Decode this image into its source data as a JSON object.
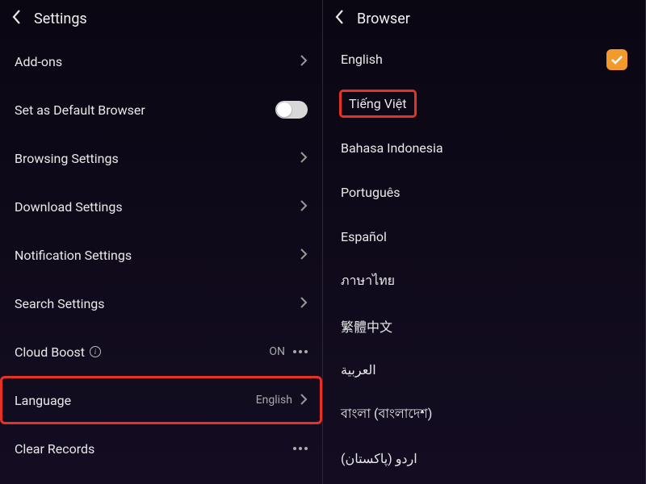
{
  "left": {
    "title": "Settings",
    "items": [
      {
        "label": "Add-ons",
        "type": "chevron"
      },
      {
        "label": "Set as Default Browser",
        "type": "toggle",
        "toggled": false
      },
      {
        "label": "Browsing Settings",
        "type": "chevron"
      },
      {
        "label": "Download Settings",
        "type": "chevron"
      },
      {
        "label": "Notification Settings",
        "type": "chevron"
      },
      {
        "label": "Search Settings",
        "type": "chevron"
      },
      {
        "label": "Cloud Boost",
        "type": "status-dots",
        "info": true,
        "status": "ON"
      },
      {
        "label": "Language",
        "type": "value-chevron",
        "value": "English",
        "highlight": true
      },
      {
        "label": "Clear Records",
        "type": "dots"
      }
    ]
  },
  "right": {
    "title": "Browser",
    "languages": [
      {
        "name": "English",
        "selected": true
      },
      {
        "name": "Tiếng Việt",
        "highlight": true
      },
      {
        "name": "Bahasa Indonesia"
      },
      {
        "name": "Português"
      },
      {
        "name": "Español"
      },
      {
        "name": "ภาษาไทย"
      },
      {
        "name": "繁體中文"
      },
      {
        "name": "العربية"
      },
      {
        "name": "বাংলা (বাংলাদেশ)"
      },
      {
        "name": "اردو (پاکستان)"
      }
    ]
  }
}
